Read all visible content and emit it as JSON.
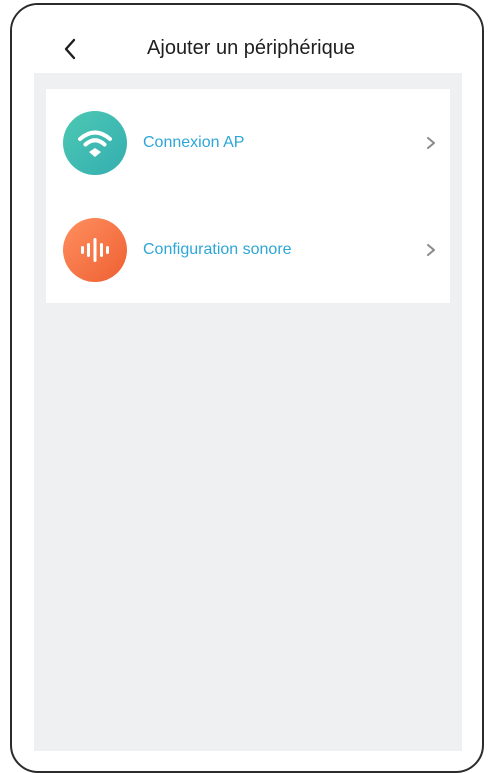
{
  "header": {
    "title": "Ajouter un périphérique",
    "back_icon": "chevron-left-icon"
  },
  "options": [
    {
      "label": "Connexion AP",
      "icon": "wifi-icon",
      "color": "#3dbab2"
    },
    {
      "label": "Configuration sonore",
      "icon": "sound-wave-icon",
      "color": "#f5734a"
    }
  ],
  "colors": {
    "label_text": "#2ea6d8",
    "background": "#eff0f2",
    "chevron": "#8a8a8a"
  }
}
